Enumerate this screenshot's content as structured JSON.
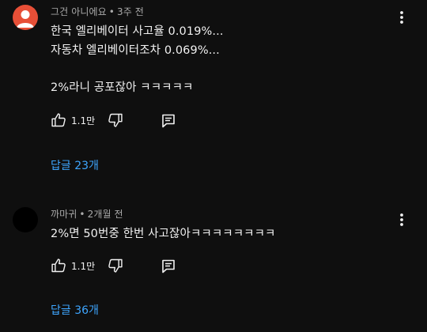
{
  "colors": {
    "background": "#0f0f0f",
    "text_primary": "#f1f1f1",
    "text_secondary": "#aaaaaa",
    "link": "#3ea6ff",
    "avatar_1": "#e74f37",
    "avatar_2": "#000000"
  },
  "comments": [
    {
      "author": "그건 아니에요",
      "separator": "•",
      "time": "3주 전",
      "lines": [
        "한국 엘리베이터 사고율 0.019%...",
        "자동차 엘리베이터조차 0.069%...",
        "",
        "2%라니 공포잖아 ㅋㅋㅋㅋㅋ"
      ],
      "likes": "1.1만",
      "replies_label": "답글 23개",
      "icons": {
        "avatar": "default-person-avatar-icon",
        "like": "thumb-up-icon",
        "dislike": "thumb-down-icon",
        "reply": "reply-icon",
        "more": "more-vertical-icon"
      }
    },
    {
      "author": "까마귀",
      "separator": "•",
      "time": "2개월 전",
      "lines": [
        "2%면 50번중 한번 사고잖아ㅋㅋㅋㅋㅋㅋㅋㅋ"
      ],
      "likes": "1.1만",
      "replies_label": "답글 36개",
      "icons": {
        "avatar": "black-avatar",
        "like": "thumb-up-icon",
        "dislike": "thumb-down-icon",
        "reply": "reply-icon",
        "more": "more-vertical-icon"
      }
    }
  ]
}
